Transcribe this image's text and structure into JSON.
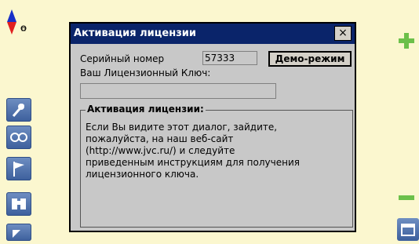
{
  "dialog": {
    "title": "Активация лицензии",
    "close_label": "×",
    "serial_label": "Серийный номер",
    "serial_value": "57333",
    "demo_button": "Демо-режим",
    "key_label": "Ваш Лицензионный Ключ:",
    "key_value": "",
    "group_title": "Активация лицензии:",
    "group_text": "Если Вы видите этот диалог, зайдите,\nпожалуйста, на наш веб-сайт\n(http://www.jvc.ru/) и следуйте\nприведенным инструкциям для получения\nлицензионного ключа."
  },
  "toolbar": {
    "left_buttons": [
      "satellite-icon",
      "glasses-icon",
      "flag-icon",
      "binoculars-icon",
      "arrow-icon"
    ],
    "right_buttons": [
      "zoom-in-icon",
      "zoom-out-icon",
      "window-icon"
    ]
  },
  "colors": {
    "background": "#fbf7cf",
    "titlebar": "#0a246a",
    "dialog": "#c8c8c8",
    "tool_button": "#4a6aa8",
    "zoom": "#6cc04a"
  }
}
